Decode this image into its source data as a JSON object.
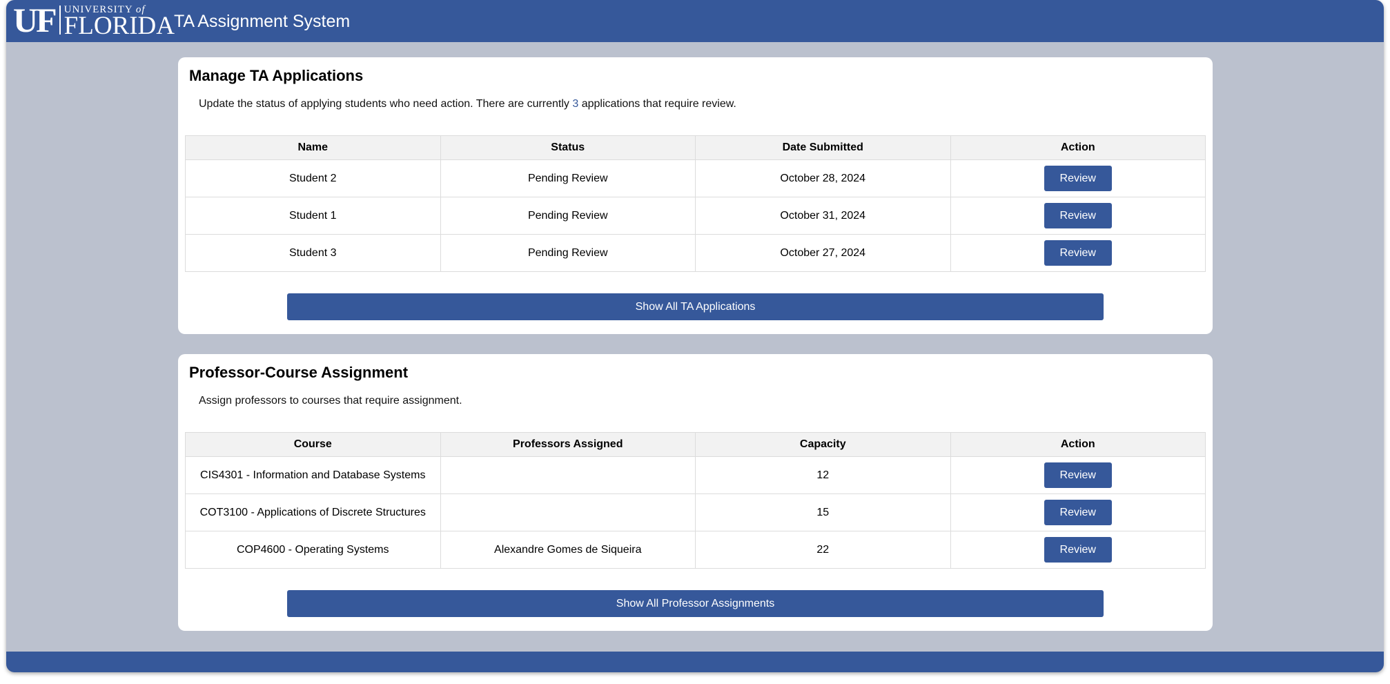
{
  "header": {
    "logo": {
      "uf": "UF",
      "university": "UNIVERSITY",
      "of": "of",
      "florida": "FLORIDA"
    },
    "title": "TA Assignment System"
  },
  "colors": {
    "brand": "#36589a",
    "background": "#bbc1ce",
    "card": "#ffffff"
  },
  "applications": {
    "title": "Manage TA Applications",
    "description_before": "Update the status of applying students who need action. There are currently ",
    "count": "3",
    "description_after": " applications that require review.",
    "columns": [
      "Name",
      "Status",
      "Date Submitted",
      "Action"
    ],
    "rows": [
      {
        "name": "Student 2",
        "status": "Pending Review",
        "date": "October 28, 2024",
        "action": "Review"
      },
      {
        "name": "Student 1",
        "status": "Pending Review",
        "date": "October 31, 2024",
        "action": "Review"
      },
      {
        "name": "Student 3",
        "status": "Pending Review",
        "date": "October 27, 2024",
        "action": "Review"
      }
    ],
    "show_all_label": "Show All TA Applications"
  },
  "assignments": {
    "title": "Professor-Course Assignment",
    "description": "Assign professors to courses that require assignment.",
    "columns": [
      "Course",
      "Professors Assigned",
      "Capacity",
      "Action"
    ],
    "rows": [
      {
        "course": "CIS4301 - Information and Database Systems",
        "professors": "",
        "capacity": "12",
        "action": "Review"
      },
      {
        "course": "COT3100 - Applications of Discrete Structures",
        "professors": "",
        "capacity": "15",
        "action": "Review"
      },
      {
        "course": "COP4600 - Operating Systems",
        "professors": "Alexandre Gomes de Siqueira",
        "capacity": "22",
        "action": "Review"
      }
    ],
    "show_all_label": "Show All Professor Assignments"
  }
}
